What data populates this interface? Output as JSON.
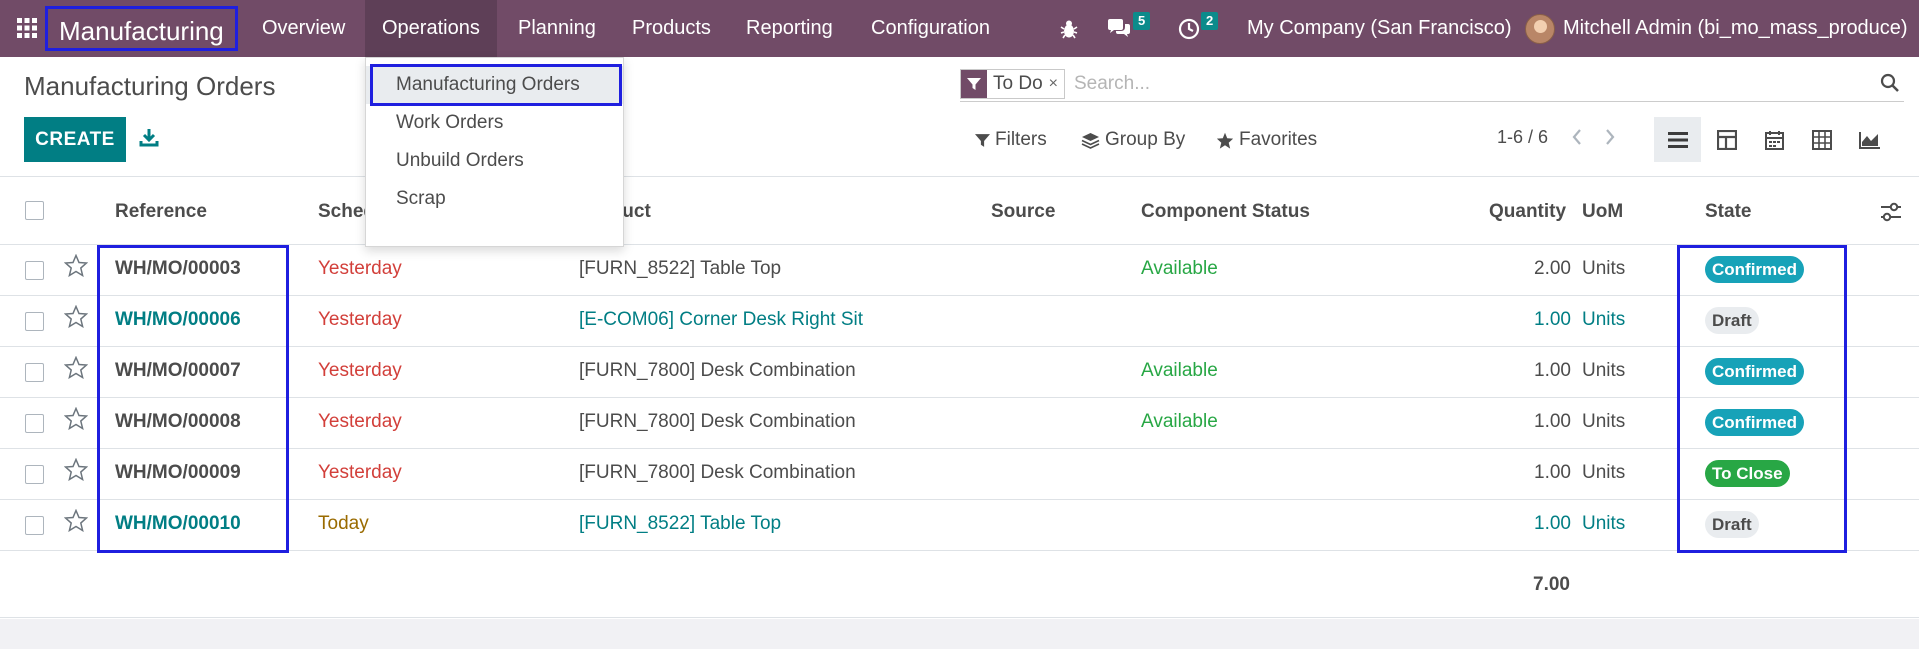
{
  "navbar": {
    "app_name": "Manufacturing",
    "menu": [
      "Overview",
      "Operations",
      "Planning",
      "Products",
      "Reporting",
      "Configuration"
    ],
    "messages_count": "5",
    "activities_count": "2",
    "company": "My Company (San Francisco)",
    "user": "Mitchell Admin (bi_mo_mass_produce)"
  },
  "operations_menu": {
    "items": [
      "Manufacturing Orders",
      "Work Orders",
      "Unbuild Orders",
      "Scrap"
    ],
    "active_index": 0
  },
  "page": {
    "title": "Manufacturing Orders",
    "create_label": "CREATE"
  },
  "search": {
    "facet": "To Do",
    "facet_close": "×",
    "placeholder": "Search..."
  },
  "controls": {
    "filters": "Filters",
    "group_by": "Group By",
    "favorites": "Favorites",
    "pager": "1-6 / 6",
    "views": [
      "list-view-icon",
      "kanban-view-icon",
      "calendar-view-icon",
      "pivot-view-icon",
      "graph-view-icon"
    ],
    "active_view": "list"
  },
  "table": {
    "headers": {
      "reference": "Reference",
      "scheduled": "Scheduled Date",
      "product": "Product",
      "source": "Source",
      "component_status": "Component Status",
      "quantity": "Quantity",
      "uom": "UoM",
      "state": "State"
    },
    "rows": [
      {
        "reference": "WH/MO/00003",
        "scheduled": "Yesterday",
        "product": "[FURN_8522] Table Top",
        "source": "",
        "component_status": "Available",
        "quantity": "2.00",
        "uom": "Units",
        "state": "Confirmed"
      },
      {
        "reference": "WH/MO/00006",
        "scheduled": "Yesterday",
        "product": "[E-COM06] Corner Desk Right Sit",
        "source": "",
        "component_status": "",
        "quantity": "1.00",
        "uom": "Units",
        "state": "Draft"
      },
      {
        "reference": "WH/MO/00007",
        "scheduled": "Yesterday",
        "product": "[FURN_7800] Desk Combination",
        "source": "",
        "component_status": "Available",
        "quantity": "1.00",
        "uom": "Units",
        "state": "Confirmed"
      },
      {
        "reference": "WH/MO/00008",
        "scheduled": "Yesterday",
        "product": "[FURN_7800] Desk Combination",
        "source": "",
        "component_status": "Available",
        "quantity": "1.00",
        "uom": "Units",
        "state": "Confirmed"
      },
      {
        "reference": "WH/MO/00009",
        "scheduled": "Yesterday",
        "product": "[FURN_7800] Desk Combination",
        "source": "",
        "component_status": "",
        "quantity": "1.00",
        "uom": "Units",
        "state": "To Close"
      },
      {
        "reference": "WH/MO/00010",
        "scheduled": "Today",
        "product": "[FURN_8522] Table Top",
        "source": "",
        "component_status": "",
        "quantity": "1.00",
        "uom": "Units",
        "state": "Draft"
      }
    ],
    "total_quantity": "7.00"
  },
  "colors": {
    "navbar": "#714b67",
    "primary": "#017e84",
    "late": "#d23f3a",
    "available": "#28a745",
    "confirmed": "#17a2b8",
    "highlight": "#1f1fdf"
  }
}
